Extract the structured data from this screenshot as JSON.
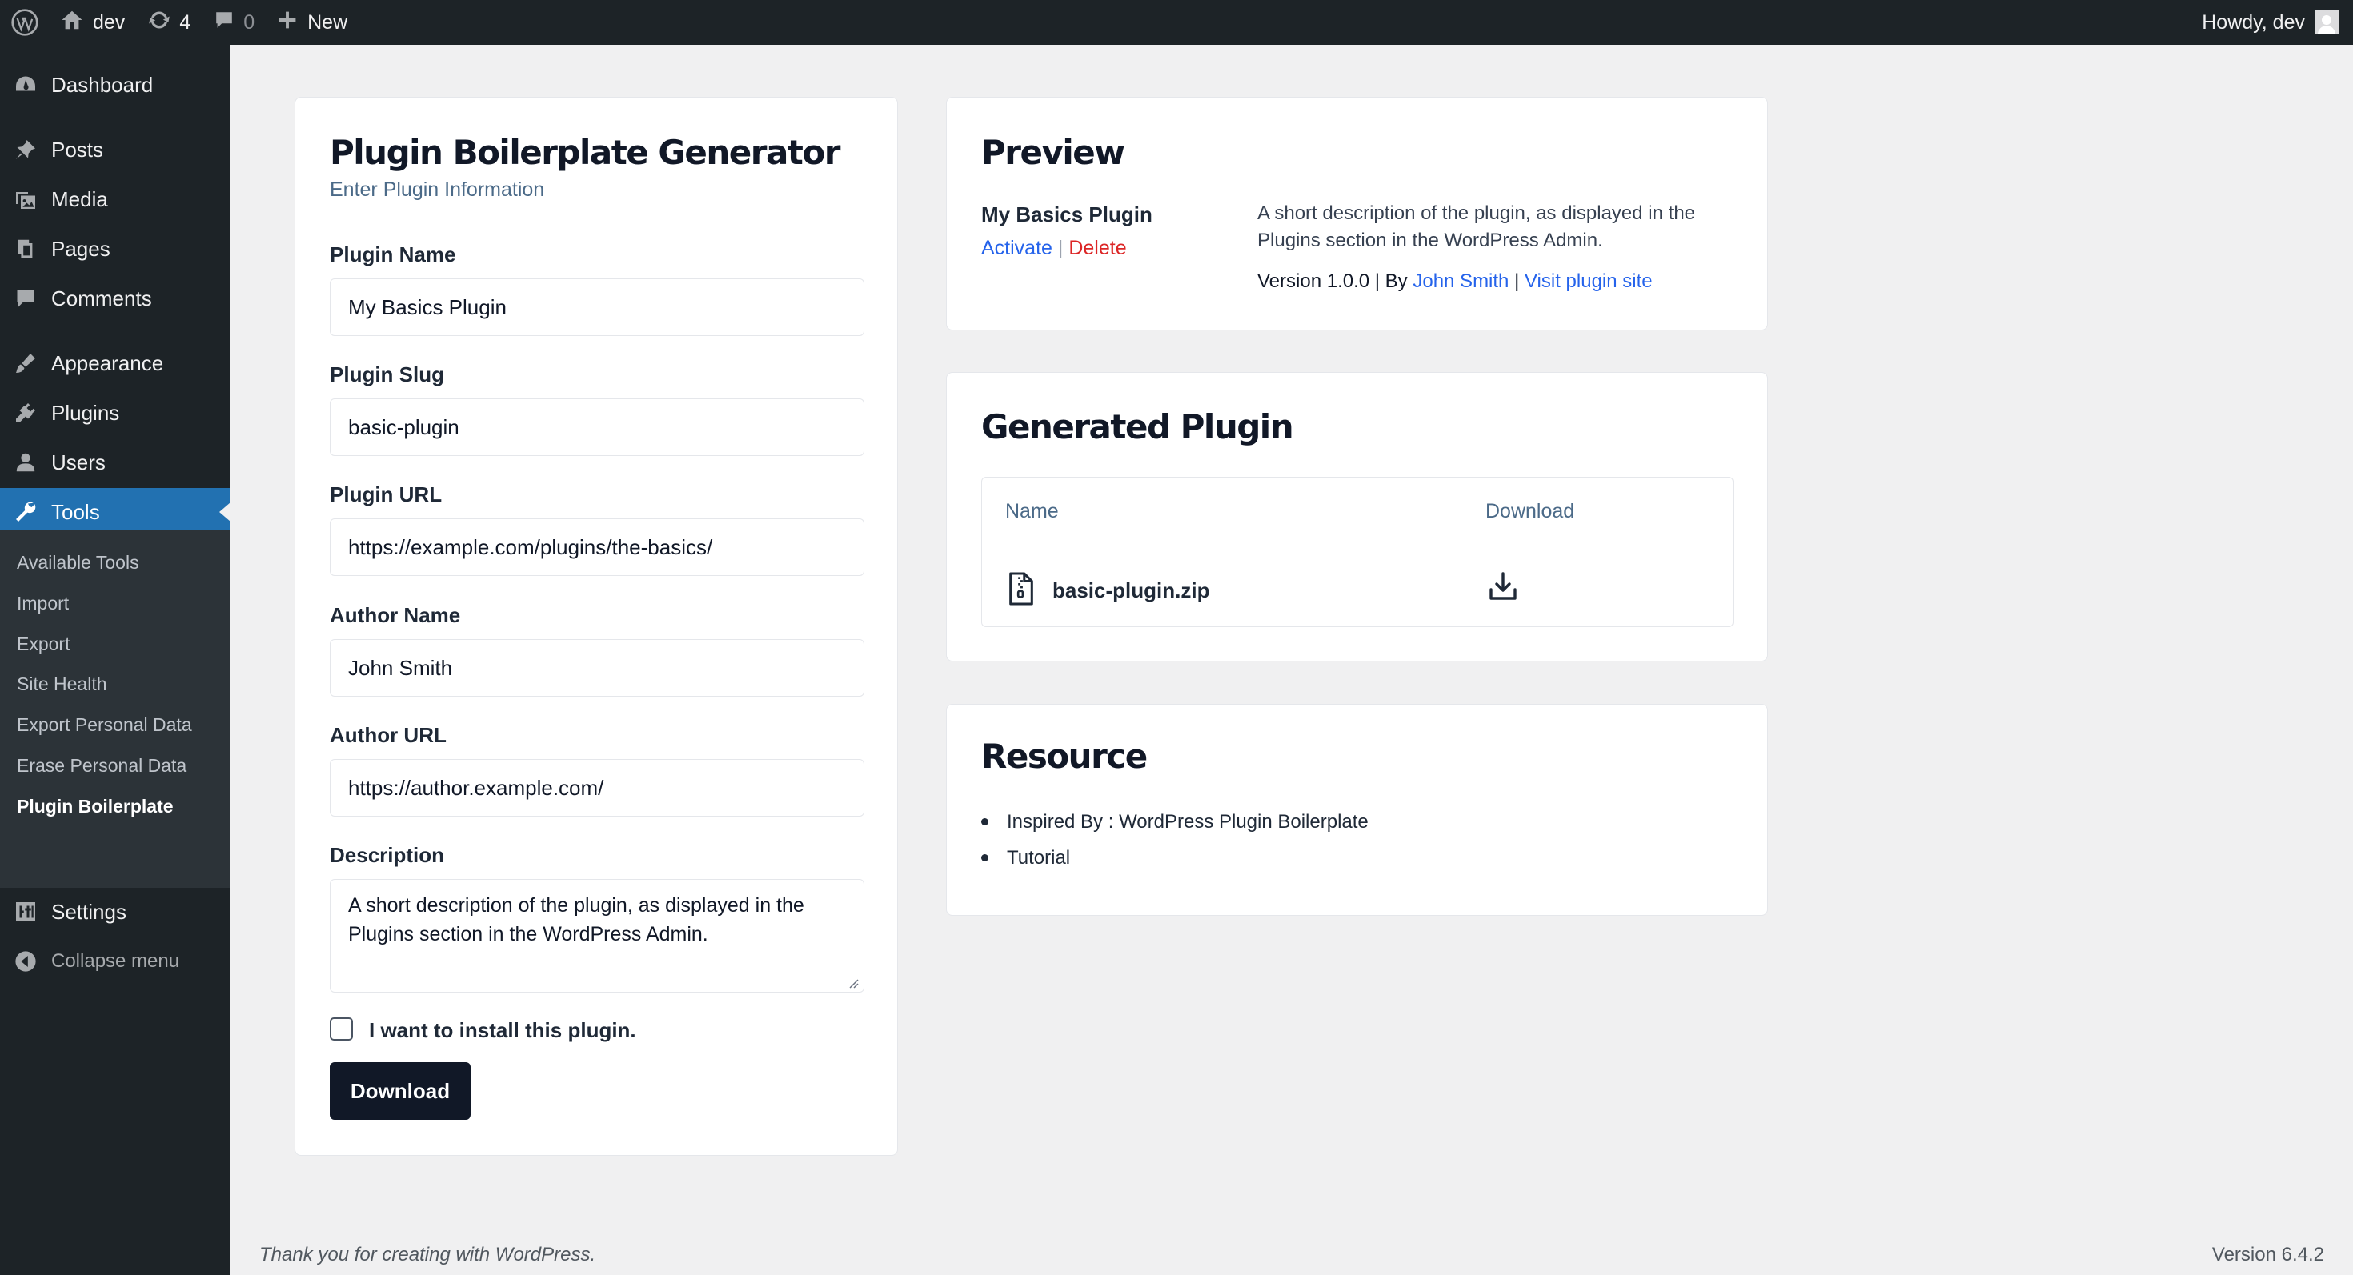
{
  "adminbar": {
    "site_name": "dev",
    "updates_count": "4",
    "comments_count": "0",
    "new_label": "New",
    "howdy": "Howdy, dev",
    "icons": [
      "wordpress-logo-icon",
      "home-icon",
      "updates-icon",
      "comment-icon",
      "plus-icon",
      "avatar"
    ]
  },
  "sidebar": {
    "items": [
      {
        "label": "Dashboard",
        "icon": "dashboard-icon"
      },
      {
        "label": "Posts",
        "icon": "pin-icon"
      },
      {
        "label": "Media",
        "icon": "media-icon"
      },
      {
        "label": "Pages",
        "icon": "pages-icon"
      },
      {
        "label": "Comments",
        "icon": "comment-icon"
      },
      {
        "label": "Appearance",
        "icon": "brush-icon"
      },
      {
        "label": "Plugins",
        "icon": "plug-icon"
      },
      {
        "label": "Users",
        "icon": "user-icon"
      },
      {
        "label": "Tools",
        "icon": "wrench-icon",
        "current": true
      },
      {
        "label": "Settings",
        "icon": "sliders-icon"
      }
    ],
    "submenu": [
      "Available Tools",
      "Import",
      "Export",
      "Site Health",
      "Export Personal Data",
      "Erase Personal Data",
      "Plugin Boilerplate"
    ],
    "submenu_active": "Plugin Boilerplate",
    "collapse_label": "Collapse menu"
  },
  "form": {
    "title": "Plugin Boilerplate Generator",
    "subtitle": "Enter Plugin Information",
    "plugin_name_label": "Plugin Name",
    "plugin_name_value": "My Basics Plugin",
    "plugin_slug_label": "Plugin Slug",
    "plugin_slug_value": "basic-plugin",
    "plugin_url_label": "Plugin URL",
    "plugin_url_value": "https://example.com/plugins/the-basics/",
    "author_name_label": "Author Name",
    "author_name_value": "John Smith",
    "author_url_label": "Author URL",
    "author_url_value": "https://author.example.com/",
    "description_label": "Description",
    "description_value": "A short description of the plugin, as displayed in the Plugins section in the WordPress Admin.",
    "install_label": "I want to install this plugin.",
    "install_checked": false,
    "download_label": "Download"
  },
  "preview": {
    "title": "Preview",
    "plugin_name": "My Basics Plugin",
    "activate_label": "Activate",
    "separator": "|",
    "delete_label": "Delete",
    "description": "A short description of the plugin, as displayed in the Plugins section in the WordPress Admin.",
    "version_prefix": "Version 1.0.0 | By ",
    "author": "John Smith",
    "meta_separator": " | ",
    "visit_label": "Visit plugin site"
  },
  "generated": {
    "title": "Generated Plugin",
    "col_name": "Name",
    "col_download": "Download",
    "file_name": "basic-plugin.zip"
  },
  "resource": {
    "title": "Resource",
    "items": [
      "Inspired By : WordPress Plugin Boilerplate",
      "Tutorial"
    ]
  },
  "footer": {
    "thanks": "Thank you for creating with WordPress.",
    "version": "Version 6.4.2"
  },
  "colors": {
    "adminbar_bg": "#1d2327",
    "accent": "#2271b1",
    "link": "#2563eb",
    "danger": "#dc2626",
    "button_bg": "#111827"
  }
}
